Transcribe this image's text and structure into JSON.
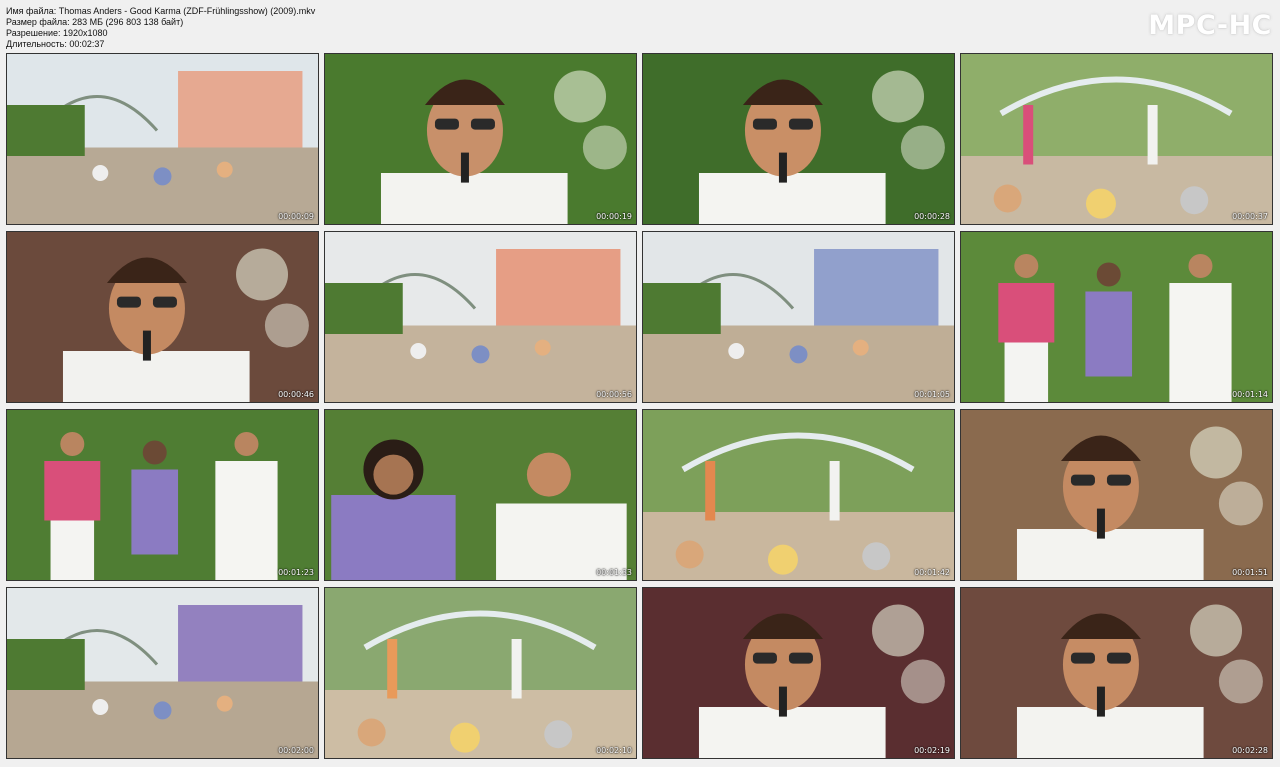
{
  "info": {
    "filename": "Имя файла: Thomas Anders - Good Karma (ZDF-Frühlingsshow) (2009).mkv",
    "filesize": "Размер файла: 283 МБ (296 803 138 байт)",
    "resolution": "Разрешение: 1920x1080",
    "duration": "Длительность: 00:02:37"
  },
  "logo": "MPC-HC",
  "thumbnails": [
    {
      "time": "00:00:09",
      "scene": "plaza",
      "colors": {
        "sky": "#dfe6ea",
        "ground": "#b7a995",
        "accent": "#e79a7a"
      }
    },
    {
      "time": "00:00:19",
      "scene": "closeup",
      "colors": {
        "bg": "#4a7a2e",
        "skin": "#c8906a",
        "shirt": "#f3f3f0"
      }
    },
    {
      "time": "00:00:28",
      "scene": "closeup",
      "colors": {
        "bg": "#3f6d2a",
        "skin": "#c98f66",
        "shirt": "#f4f4f1"
      }
    },
    {
      "time": "00:00:37",
      "scene": "stage",
      "colors": {
        "bg": "#8fae6a",
        "ground": "#c8b9a2",
        "accent": "#d94f7a"
      }
    },
    {
      "time": "00:00:46",
      "scene": "closeup",
      "colors": {
        "bg": "#6b4a3c",
        "skin": "#c48a62",
        "shirt": "#f2f2ef"
      }
    },
    {
      "time": "00:00:56",
      "scene": "plaza",
      "colors": {
        "sky": "#e7e9ea",
        "ground": "#c4b39c",
        "accent": "#e68b6b"
      }
    },
    {
      "time": "00:01:05",
      "scene": "plaza",
      "colors": {
        "sky": "#e2e6e8",
        "ground": "#bfae96",
        "accent": "#7d8fc4"
      }
    },
    {
      "time": "00:01:14",
      "scene": "trio",
      "colors": {
        "bg": "#5c8a3a",
        "skin": "#b98560",
        "accent": "#d94f7a"
      }
    },
    {
      "time": "00:01:23",
      "scene": "trio",
      "colors": {
        "bg": "#4f7d33",
        "skin": "#b98560",
        "accent": "#d94f7a"
      }
    },
    {
      "time": "00:01:33",
      "scene": "duo",
      "colors": {
        "bg": "#557f35",
        "skin": "#a67452",
        "accent": "#8b7bc2"
      }
    },
    {
      "time": "00:01:42",
      "scene": "stage",
      "colors": {
        "bg": "#7da05a",
        "ground": "#c9b79e",
        "accent": "#e3884f"
      }
    },
    {
      "time": "00:01:51",
      "scene": "closeup",
      "colors": {
        "bg": "#8a6a4e",
        "skin": "#c48a62",
        "shirt": "#f3f3f0"
      }
    },
    {
      "time": "00:02:00",
      "scene": "plaza",
      "colors": {
        "sky": "#e3e8ea",
        "ground": "#b6a792",
        "accent": "#7e66b4"
      }
    },
    {
      "time": "00:02:10",
      "scene": "stage",
      "colors": {
        "bg": "#8aa870",
        "ground": "#cdbda4",
        "accent": "#e89a5a"
      }
    },
    {
      "time": "00:02:19",
      "scene": "closeup",
      "colors": {
        "bg": "#5a2e30",
        "skin": "#c48a62",
        "shirt": "#f4f4f1"
      }
    },
    {
      "time": "00:02:28",
      "scene": "closeup",
      "colors": {
        "bg": "#6e4a3e",
        "skin": "#c68c64",
        "shirt": "#f3f3f0"
      }
    }
  ]
}
